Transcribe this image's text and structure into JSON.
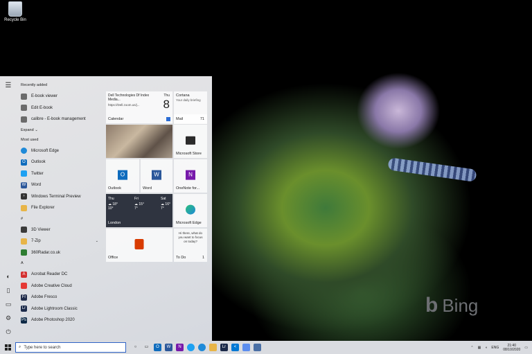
{
  "desktop": {
    "recycle_bin_label": "Recycle Bin",
    "bing_text": "Bing"
  },
  "start_menu": {
    "sections": {
      "recently_added": "Recently added",
      "most_used": "Most used",
      "hash": "#",
      "letter_a": "A"
    },
    "recently_added": [
      {
        "label": "E-book viewer",
        "icon": "ebook-icon",
        "color": "#6b6b6b"
      },
      {
        "label": "Edit E-book",
        "icon": "ebook-edit-icon",
        "color": "#6b6b6b"
      },
      {
        "label": "calibre - E-book management",
        "icon": "calibre-icon",
        "color": "#6b6b6b"
      }
    ],
    "expand_label": "Expand",
    "most_used": [
      {
        "label": "Microsoft Edge",
        "icon": "edge-icon",
        "color": "#1f8ad8"
      },
      {
        "label": "Outlook",
        "icon": "outlook-icon",
        "color": "#0f6cbd"
      },
      {
        "label": "Twitter",
        "icon": "twitter-icon",
        "color": "#1da1f2"
      },
      {
        "label": "Word",
        "icon": "word-icon",
        "color": "#2b579a"
      },
      {
        "label": "Windows Terminal Preview",
        "icon": "terminal-icon",
        "color": "#333333"
      },
      {
        "label": "File Explorer",
        "icon": "folder-icon",
        "color": "#e8b548"
      }
    ],
    "hash_apps": [
      {
        "label": "3D Viewer",
        "icon": "cube-icon",
        "color": "#3a3a3a"
      },
      {
        "label": "7-Zip",
        "icon": "folder-icon",
        "color": "#e8b548"
      },
      {
        "label": "360Radar.co.uk",
        "icon": "radar-icon",
        "color": "#2e7d32"
      }
    ],
    "a_apps": [
      {
        "label": "Acrobat Reader DC",
        "icon": "acrobat-icon",
        "color": "#d32f2f"
      },
      {
        "label": "Adobe Creative Cloud",
        "icon": "creative-cloud-icon",
        "color": "#e53935"
      },
      {
        "label": "Adobe Fresco",
        "icon": "fresco-icon",
        "color": "#1f2b4a"
      },
      {
        "label": "Adobe Lightroom Classic",
        "icon": "lightroom-icon",
        "color": "#1b2a4a"
      },
      {
        "label": "Adobe Photoshop 2020",
        "icon": "photoshop-icon",
        "color": "#0e2a47"
      }
    ],
    "tiles": {
      "calendar": {
        "event": "Dell Technologies Df Index Media...",
        "url": "https://Dell.zoom.us/j...",
        "day": "Thu",
        "date": "8",
        "label": "Calendar"
      },
      "cortana": {
        "title": "Cortana",
        "text": "Your daily briefing"
      },
      "mail": {
        "label": "Mail",
        "count": "71"
      },
      "ms_store": {
        "label": "Microsoft Store"
      },
      "outlook": {
        "label": "Outlook"
      },
      "word": {
        "label": "Word"
      },
      "onenote": {
        "label": "OneNote for..."
      },
      "weather": {
        "days": [
          {
            "day": "Thu",
            "high": "18°",
            "low": "10°"
          },
          {
            "day": "Fri",
            "high": "15°",
            "low": "7°"
          },
          {
            "day": "Sat",
            "high": "16°",
            "low": "7°"
          }
        ],
        "location": "London"
      },
      "edge": {
        "label": "Microsoft Edge"
      },
      "office": {
        "label": "Office"
      },
      "todo": {
        "text": "Hi there, what do you want to focus on today?",
        "label": "To Do",
        "count": "1"
      }
    }
  },
  "taskbar": {
    "search_placeholder": "Type here to search",
    "lang": "ENG",
    "time": "21:40",
    "date": "08/10/2020"
  }
}
